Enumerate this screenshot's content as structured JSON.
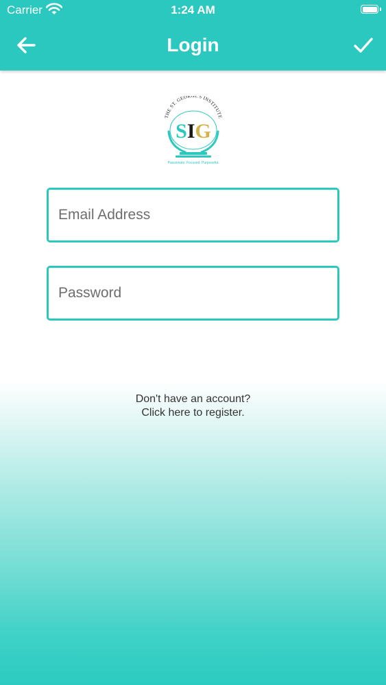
{
  "status_bar": {
    "carrier": "Carrier",
    "time": "1:24 AM",
    "wifi_icon": "wifi-icon",
    "battery_icon": "battery-icon"
  },
  "nav": {
    "title": "Login",
    "back_icon": "arrow-left-icon",
    "confirm_icon": "checkmark-icon"
  },
  "logo": {
    "arc_text": "THE ST. GEORGE'S INSTITUTE",
    "monogram": "SIG",
    "tagline": "Passionate. Focused. Purposeful."
  },
  "form": {
    "email": {
      "value": "",
      "placeholder": "Email Address"
    },
    "password": {
      "value": "",
      "placeholder": "Password"
    }
  },
  "register": {
    "line1": "Don't have an account?",
    "line2": "Click here to register."
  },
  "colors": {
    "accent": "#2bc8c0",
    "text": "#333333",
    "placeholder": "#6d6d6d"
  }
}
